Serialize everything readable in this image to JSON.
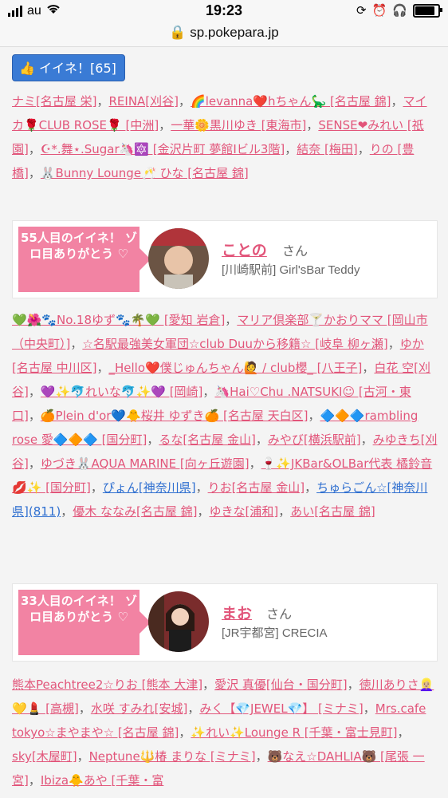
{
  "status_bar": {
    "carrier": "au",
    "time": "19:23"
  },
  "url_bar": {
    "url": "sp.pokepara.jp"
  },
  "like_button": {
    "label": "イイネ！[65]"
  },
  "likers_block_1": [
    "ナミ[名古屋 栄]",
    "REINA[刈谷]",
    "🌈levanna❤️hちゃん🦕 [名古屋 錦]",
    "マイカ🌹CLUB ROSE🌹 [中洲]",
    "一華🌼黒川ゆき [東海市]",
    "SENSE❤みれい [祇園]",
    "☪︎*.舞⋆.Sugar🦄🔯 [金沢片町 夢館Ⅰビル3階]",
    "結奈 [梅田]",
    "りの [豊橋]",
    "🐰Bunny Lounge🥂 ひな [名古屋 錦]"
  ],
  "card_1": {
    "ribbon": "55人目のイイネ！ ゾロ目ありがとう ♡",
    "name": "ことの",
    "honorific": "さん",
    "shop": "[川崎駅前] Girl'sBar Teddy"
  },
  "likers_block_2": [
    "💚🌺🐾No.18ゆず🐾🌴💚 [愛知 岩倉]",
    "マリア倶楽部🍸かおりママ [岡山市（中央町）]",
    "☆名駅最強美女軍団☆club Duuから移籍☆ [岐阜 柳ヶ瀬]",
    "ゆか[名古屋 中川区]",
    "_Hello❤️僕じゅんちゃん🙋 / club櫻_ [八王子]",
    "白花 空[刈谷]",
    "💜✨🐬れいな🐬✨💜 [岡崎]",
    "🦄Hai♡Chu .NATSUKI☺ [古河・東口]",
    "🍊Plein d'or💙🐥桜井 ゆずき🍊 [名古屋 天白区]",
    "🔷🔶🔷rambling rose 愛🔷🔶🔷 [国分町]",
    "るな[名古屋 金山]",
    "みやび[横浜駅前]",
    "みゆきち[刈谷]",
    "ゆづき🐰AQUA MARINE [向ヶ丘遊園]",
    "🍷✨JKBar&OLBar代表 橘鈴音💋✨ [国分町]",
    "ぴょん[神奈川県]",
    "りお[名古屋 金山]",
    "ちゅらごん☆[神奈川県](811)",
    "優木 ななみ[名古屋 錦]",
    "ゆきな[浦和]",
    "あい[名古屋 錦]"
  ],
  "card_2": {
    "ribbon": "33人目のイイネ！ ゾロ目ありがとう ♡",
    "name": "まお",
    "honorific": "さん",
    "shop": "[JR宇都宮] CRECIA"
  },
  "likers_block_3": [
    "熊本Peachtree2☆りお [熊本 大津]",
    "愛沢 真優[仙台・国分町]",
    "徳川ありさ👱🏼‍♀️💛💄 [高槻]",
    "水咲 すみれ[安城]",
    "みく【💎JEWEL💎】 [ミナミ]",
    "Mrs.cafe tokyo☆まやまや☆ [名古屋 錦]",
    "✨れい✨Lounge R [千葉・富士見町]",
    "sky[木屋町]",
    "Neptune🔱椿 まりな [ミナミ]",
    "🐻なえ☆DAHLIA🐻 [尾張 一宮]",
    "Ibiza🐥あや [千葉・富"
  ]
}
